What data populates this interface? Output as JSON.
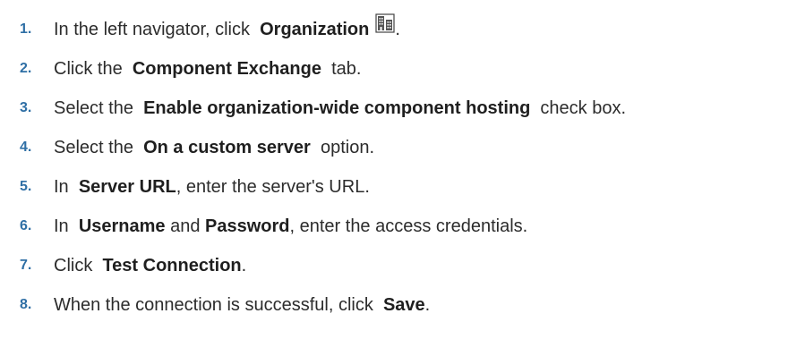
{
  "steps": [
    {
      "number": "1.",
      "parts": [
        "In the left navigator, click ",
        "Organization",
        "."
      ],
      "icon": "building-icon"
    },
    {
      "number": "2.",
      "parts": [
        "Click the ",
        "Component Exchange",
        " tab."
      ]
    },
    {
      "number": "3.",
      "parts": [
        "Select the ",
        "Enable organization-wide component hosting",
        " check box."
      ]
    },
    {
      "number": "4.",
      "parts": [
        "Select the ",
        "On a custom server",
        " option."
      ]
    },
    {
      "number": "5.",
      "parts": [
        "In ",
        "Server URL",
        ", enter the server's URL."
      ]
    },
    {
      "number": "6.",
      "parts": [
        "In ",
        "Username",
        " and ",
        "Password",
        ", enter the access credentials."
      ]
    },
    {
      "number": "7.",
      "parts": [
        "Click ",
        "Test Connection",
        "."
      ]
    },
    {
      "number": "8.",
      "parts": [
        "When the connection is successful, click ",
        "Save",
        "."
      ]
    }
  ],
  "colors": {
    "step_number": "#2f6fa5",
    "text": "#2c2c2c"
  }
}
